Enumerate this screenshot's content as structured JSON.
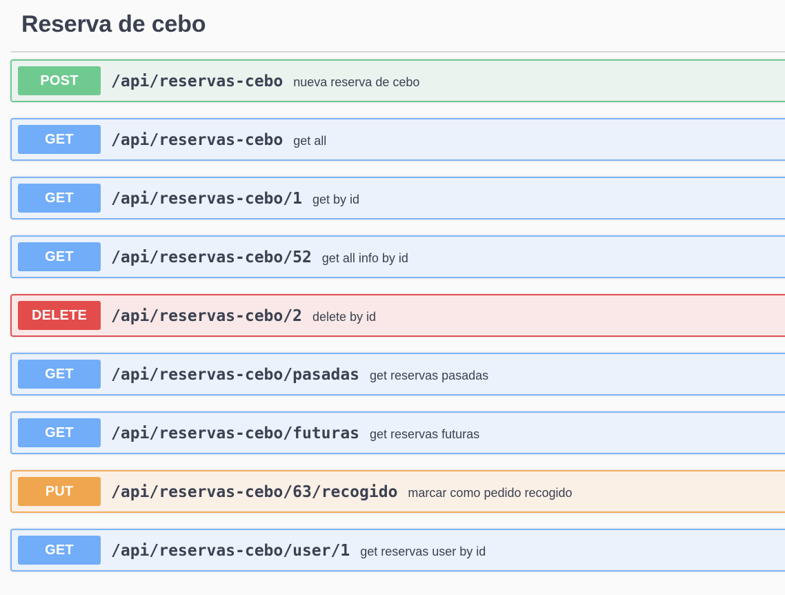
{
  "section": {
    "title": "Reserva de cebo"
  },
  "operations": [
    {
      "method": "POST",
      "path": "/api/reservas-cebo",
      "summary": "nueva reserva de cebo",
      "color": "#6fca90"
    },
    {
      "method": "GET",
      "path": "/api/reservas-cebo",
      "summary": "get all",
      "color": "#71adf8"
    },
    {
      "method": "GET",
      "path": "/api/reservas-cebo/1",
      "summary": "get by id",
      "color": "#71adf8"
    },
    {
      "method": "GET",
      "path": "/api/reservas-cebo/52",
      "summary": "get all info by id",
      "color": "#71adf8"
    },
    {
      "method": "DELETE",
      "path": "/api/reservas-cebo/2",
      "summary": "delete by id",
      "color": "#e24c4a"
    },
    {
      "method": "GET",
      "path": "/api/reservas-cebo/pasadas",
      "summary": "get reservas pasadas",
      "color": "#71adf8"
    },
    {
      "method": "GET",
      "path": "/api/reservas-cebo/futuras",
      "summary": "get reservas futuras",
      "color": "#71adf8"
    },
    {
      "method": "PUT",
      "path": "/api/reservas-cebo/63/recogido",
      "summary": "marcar como pedido recogido",
      "color": "#f0a64e"
    },
    {
      "method": "GET",
      "path": "/api/reservas-cebo/user/1",
      "summary": "get reservas user by id",
      "color": "#71adf8"
    }
  ]
}
